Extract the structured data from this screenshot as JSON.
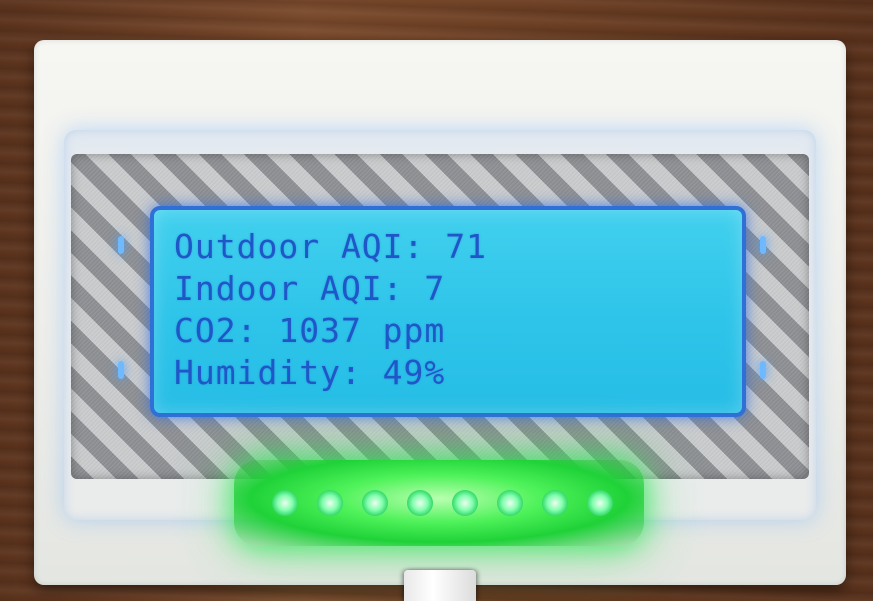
{
  "display": {
    "lines": [
      "Outdoor AQI: 71",
      "Indoor AQI: 7",
      "CO2: 1037 ppm",
      "Humidity: 49%"
    ]
  },
  "colors": {
    "lcd_background": "#2fc5ea",
    "lcd_text": "#1f57c8",
    "led_glow": "#2fdc52",
    "enclosure": "#f0f0ec"
  },
  "led_strip": {
    "led_count": 8
  }
}
